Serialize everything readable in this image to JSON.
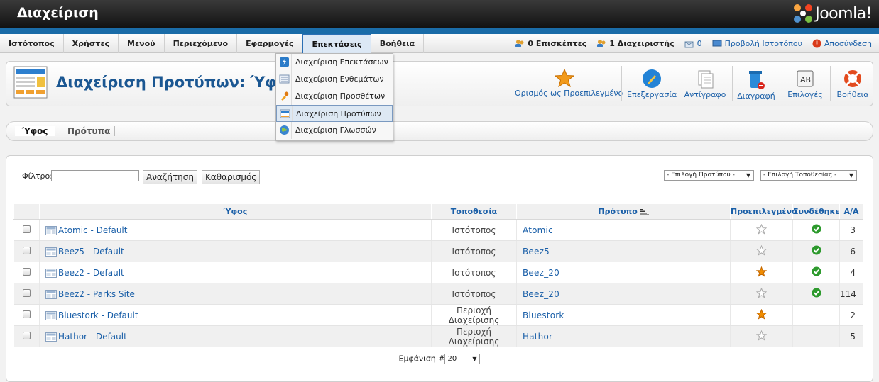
{
  "app": {
    "title": "Διαχείριση",
    "brand": "Joomla!"
  },
  "menu": [
    "Ιστότοπος",
    "Χρήστες",
    "Μενού",
    "Περιεχόμενο",
    "Εφαρμογές",
    "Επεκτάσεις",
    "Βοήθεια"
  ],
  "status": {
    "visitors": "0 Επισκέπτες",
    "admins": "1 Διαχειριστής",
    "messages": "0",
    "view_site": "Προβολή Ιστοτόπου",
    "logout": "Αποσύνδεση"
  },
  "dropdown": {
    "items": [
      {
        "label": "Διαχείριση Επεκτάσεων",
        "icon": "extension-icon"
      },
      {
        "label": "Διαχείριση Ενθεμάτων",
        "icon": "module-icon"
      },
      {
        "label": "Διαχείριση Προσθέτων",
        "icon": "plugin-icon"
      },
      {
        "label": "Διαχείριση Προτύπων",
        "icon": "template-icon",
        "selected": true
      },
      {
        "label": "Διαχείριση Γλωσσών",
        "icon": "language-globe-icon"
      }
    ]
  },
  "page": {
    "title": "Διαχείριση Προτύπων: Ύφος"
  },
  "toolbar": {
    "default_label": "Ορισμός ως Προεπιλεγμένο",
    "edit_label": "Επεξεργασία",
    "copy_label": "Αντίγραφο",
    "delete_label": "Διαγραφή",
    "options_label": "Επιλογές",
    "help_label": "Βοήθεια"
  },
  "subnav": {
    "styles": "Ύφος",
    "templates": "Πρότυπα"
  },
  "filter": {
    "label": "Φίλτρο:",
    "value": "",
    "search_button": "Αναζήτηση",
    "clear_button": "Καθαρισμός",
    "template_select": "- Επιλογή Προτύπου -",
    "location_select": "- Επιλογή Τοποθεσίας -"
  },
  "table": {
    "headers": {
      "style": "Ύφος",
      "location": "Τοποθεσία",
      "template": "Πρότυπο",
      "default": "Προεπιλεγμένο",
      "assigned": "Συνδέθηκε",
      "id": "Α/Α"
    },
    "rows": [
      {
        "style": "Atomic - Default",
        "location": "Ιστότοπος",
        "template": "Atomic",
        "default": false,
        "assigned": true,
        "id": "3"
      },
      {
        "style": "Beez5 - Default",
        "location": "Ιστότοπος",
        "template": "Beez5",
        "default": false,
        "assigned": true,
        "id": "6"
      },
      {
        "style": "Beez2 - Default",
        "location": "Ιστότοπος",
        "template": "Beez_20",
        "default": true,
        "assigned": true,
        "id": "4"
      },
      {
        "style": "Beez2 - Parks Site",
        "location": "Ιστότοπος",
        "template": "Beez_20",
        "default": false,
        "assigned": true,
        "id": "114"
      },
      {
        "style": "Bluestork - Default",
        "location": "Περιοχή Διαχείρισης",
        "template": "Bluestork",
        "default": true,
        "assigned": false,
        "id": "2"
      },
      {
        "style": "Hathor - Default",
        "location": "Περιοχή Διαχείρισης",
        "template": "Hathor",
        "default": false,
        "assigned": false,
        "id": "5"
      }
    ]
  },
  "pagination": {
    "label": "Εμφάνιση #",
    "value": "20"
  },
  "colors": {
    "link": "#1a5fa8",
    "title": "#1b5792",
    "accent_bar": "#1a6ca8",
    "star_active": "#f08c00",
    "check": "#2d9a2d"
  }
}
